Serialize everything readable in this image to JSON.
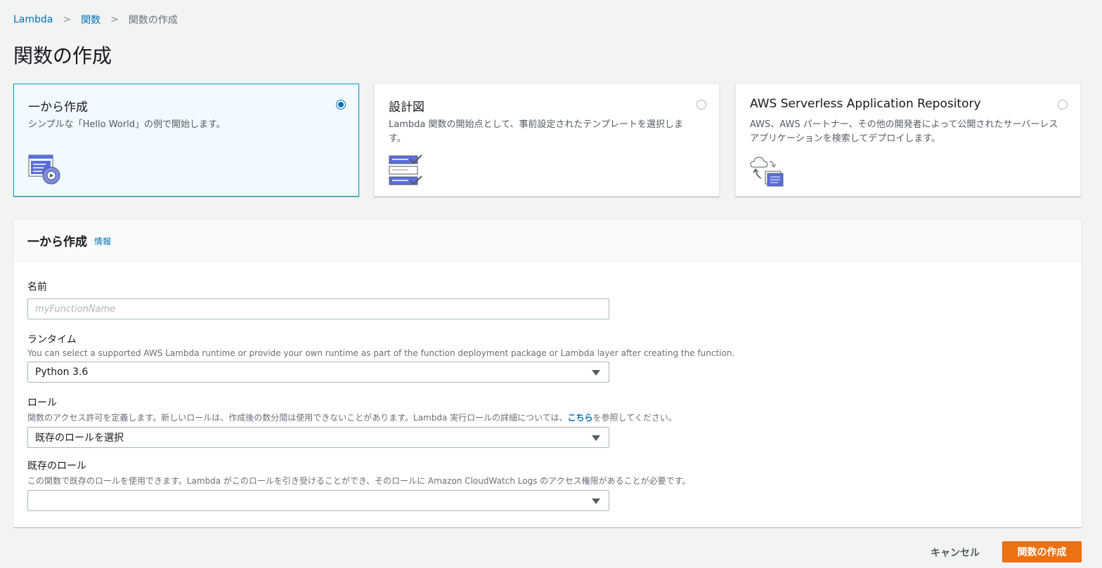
{
  "breadcrumb": {
    "root": "Lambda",
    "parent": "関数",
    "current": "関数の作成"
  },
  "page": {
    "title": "関数の作成"
  },
  "cards": [
    {
      "title": "一から作成",
      "desc": "シンプルな「Hello World」の例で開始します。",
      "selected": true,
      "icon": "author-from-scratch-icon"
    },
    {
      "title": "設計図",
      "desc": "Lambda 関数の開始点として、事前設定されたテンプレートを選択します。",
      "selected": false,
      "icon": "blueprint-icon"
    },
    {
      "title": "AWS Serverless Application Repository",
      "desc": "AWS、AWS パートナー、その他の開発者によって公開されたサーバーレスアプリケーションを検索してデプロイします。",
      "selected": false,
      "icon": "serverless-repo-icon"
    }
  ],
  "panel": {
    "title": "一から作成",
    "info": "情報",
    "name": {
      "label": "名前",
      "placeholder": "myFunctionName"
    },
    "runtime": {
      "label": "ランタイム",
      "desc": "You can select a supported AWS Lambda runtime or provide your own runtime as part of the function deployment package or Lambda layer after creating the function.",
      "value": "Python 3.6"
    },
    "role": {
      "label": "ロール",
      "desc_before": "関数のアクセス許可を定義します。新しいロールは、作成後の数分間は使用できないことがあります。Lambda 実行ロールの詳細については、",
      "desc_link": "こちら",
      "desc_after": "を参照してください。",
      "value": "既存のロールを選択"
    },
    "existing_role": {
      "label": "既存のロール",
      "desc": "この関数で既存のロールを使用できます。Lambda がこのロールを引き受けることができ、そのロールに Amazon CloudWatch Logs のアクセス権限があることが必要です。",
      "value": ""
    }
  },
  "footer": {
    "cancel": "キャンセル",
    "create": "関数の作成"
  },
  "colors": {
    "accent": "#ec7211",
    "link": "#0073bb",
    "selected_bg": "#f1faff",
    "icon_blue": "#5a6ee0"
  }
}
